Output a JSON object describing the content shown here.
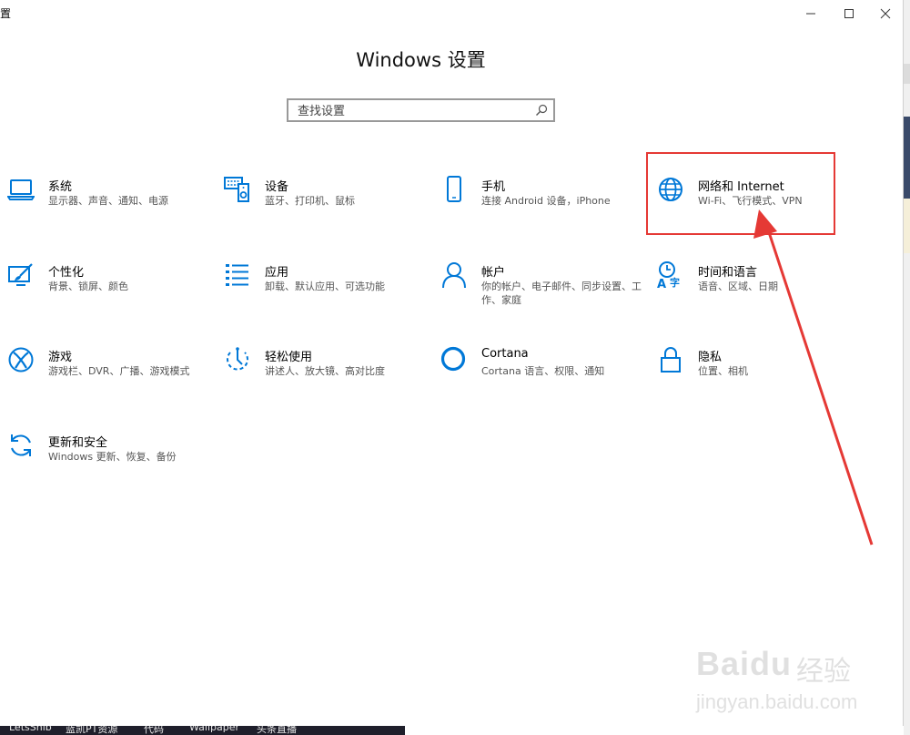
{
  "window": {
    "title": "置",
    "heading": "Windows 设置",
    "controls": {
      "minimize": "—",
      "maximize": "☐",
      "close": "✕"
    }
  },
  "search": {
    "placeholder": "查找设置"
  },
  "tiles": [
    {
      "label": "系统",
      "desc": "显示器、声音、通知、电源",
      "icon": "laptop-icon"
    },
    {
      "label": "设备",
      "desc": "蓝牙、打印机、鼠标",
      "icon": "keyboard-speaker-icon"
    },
    {
      "label": "手机",
      "desc": "连接 Android 设备，iPhone",
      "icon": "phone-icon"
    },
    {
      "label": "网络和 Internet",
      "desc": "Wi-Fi、飞行模式、VPN",
      "icon": "globe-icon"
    },
    {
      "label": "个性化",
      "desc": "背景、锁屏、颜色",
      "icon": "paint-icon"
    },
    {
      "label": "应用",
      "desc": "卸载、默认应用、可选功能",
      "icon": "list-icon"
    },
    {
      "label": "帐户",
      "desc": "你的帐户、电子邮件、同步设置、工作、家庭",
      "icon": "person-icon"
    },
    {
      "label": "时间和语言",
      "desc": "语音、区域、日期",
      "icon": "time-language-icon"
    },
    {
      "label": "游戏",
      "desc": "游戏栏、DVR、广播、游戏模式",
      "icon": "xbox-icon"
    },
    {
      "label": "轻松使用",
      "desc": "讲述人、放大镜、高对比度",
      "icon": "ease-of-access-icon"
    },
    {
      "label": "Cortana",
      "desc": "Cortana 语言、权限、通知",
      "icon": "cortana-icon"
    },
    {
      "label": "隐私",
      "desc": "位置、相机",
      "icon": "lock-icon"
    },
    {
      "label": "更新和安全",
      "desc": "Windows 更新、恢复、备份",
      "icon": "sync-icon"
    }
  ],
  "taskbar": [
    "LetsShib",
    "蓝凯PT资源",
    "代码",
    "Wallpaper",
    "头条直播"
  ],
  "watermark": {
    "brand": "Baidu",
    "product": "经验",
    "url": "jingyan.baidu.com"
  },
  "colors": {
    "accent": "#0078d7",
    "highlight": "#e53935"
  }
}
